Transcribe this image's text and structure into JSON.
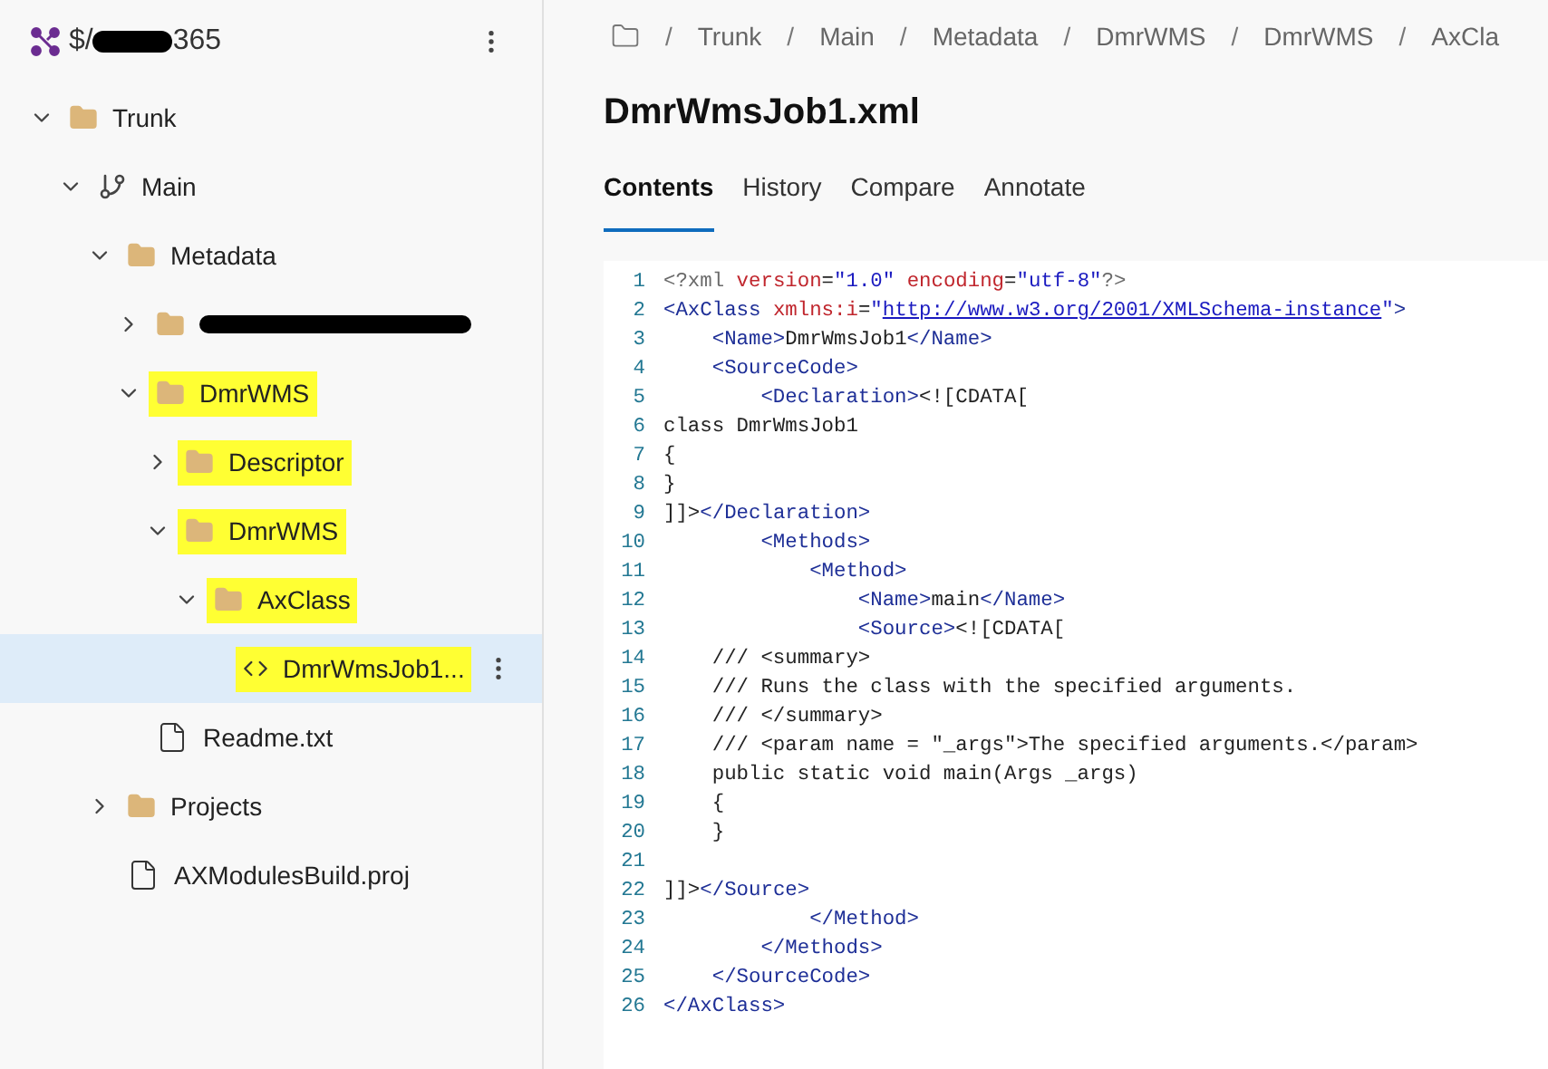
{
  "sidebar": {
    "repo": {
      "prefix": "$/",
      "suffix": "365",
      "redacted": true
    },
    "tree": [
      {
        "kind": "folder",
        "label": "Trunk",
        "expanded": true,
        "highlighted": false,
        "selected": false,
        "children": [
          {
            "kind": "branch",
            "label": "Main",
            "expanded": true,
            "highlighted": false,
            "selected": false,
            "children": [
              {
                "kind": "folder",
                "label": "Metadata",
                "expanded": true,
                "highlighted": false,
                "selected": false,
                "children": [
                  {
                    "kind": "folder",
                    "redacted": true,
                    "expanded": false,
                    "highlighted": false,
                    "selected": false
                  },
                  {
                    "kind": "folder",
                    "label": "DmrWMS",
                    "expanded": true,
                    "highlighted": true,
                    "selected": false,
                    "children": [
                      {
                        "kind": "folder",
                        "label": "Descriptor",
                        "expanded": false,
                        "highlighted": true,
                        "selected": false
                      },
                      {
                        "kind": "folder",
                        "label": "DmrWMS",
                        "expanded": true,
                        "highlighted": true,
                        "selected": false,
                        "children": [
                          {
                            "kind": "folder",
                            "label": "AxClass",
                            "expanded": true,
                            "highlighted": true,
                            "selected": false,
                            "children": [
                              {
                                "kind": "code",
                                "label": "DmrWmsJob1...",
                                "highlighted": true,
                                "selected": true
                              }
                            ]
                          }
                        ]
                      }
                    ]
                  },
                  {
                    "kind": "file",
                    "label": "Readme.txt",
                    "highlighted": false,
                    "selected": false
                  }
                ]
              },
              {
                "kind": "folder",
                "label": "Projects",
                "expanded": false,
                "highlighted": false,
                "selected": false
              },
              {
                "kind": "file",
                "label": "AXModulesBuild.proj",
                "highlighted": false,
                "selected": false
              }
            ]
          }
        ]
      }
    ]
  },
  "breadcrumb": [
    {
      "separator": "/",
      "label": "Trunk"
    },
    {
      "separator": "/",
      "label": "Main"
    },
    {
      "separator": "/",
      "label": "Metadata"
    },
    {
      "separator": "/",
      "label": "DmrWMS"
    },
    {
      "separator": "/",
      "label": "DmrWMS"
    },
    {
      "separator": "/",
      "label": "AxCla"
    }
  ],
  "title": "DmrWmsJob1.xml",
  "tabs": [
    {
      "label": "Contents",
      "selected": true
    },
    {
      "label": "History",
      "selected": false
    },
    {
      "label": "Compare",
      "selected": false
    },
    {
      "label": "Annotate",
      "selected": false
    }
  ],
  "code": [
    {
      "number": "1",
      "tokens": [
        {
          "kind": "punct",
          "text": "<?xml "
        },
        {
          "kind": "attr",
          "text": "version"
        },
        {
          "kind": "text",
          "text": "="
        },
        {
          "kind": "value",
          "text": "\"1.0\" "
        },
        {
          "kind": "attr",
          "text": "encoding"
        },
        {
          "kind": "text",
          "text": "="
        },
        {
          "kind": "value",
          "text": "\"utf-8\""
        },
        {
          "kind": "punct",
          "text": "?>"
        }
      ]
    },
    {
      "number": "2",
      "tokens": [
        {
          "kind": "tag",
          "text": "<AxClass "
        },
        {
          "kind": "attr",
          "text": "xmlns:i"
        },
        {
          "kind": "text",
          "text": "="
        },
        {
          "kind": "value",
          "text": "\""
        },
        {
          "kind": "link",
          "text": "http://www.w3.org/2001/XMLSchema-instance"
        },
        {
          "kind": "value",
          "text": "\""
        },
        {
          "kind": "tag",
          "text": ">"
        }
      ]
    },
    {
      "number": "3",
      "tokens": [
        {
          "kind": "tag",
          "text": "    <Name>"
        },
        {
          "kind": "text",
          "text": "DmrWmsJob1"
        },
        {
          "kind": "tag",
          "text": "</Name>"
        }
      ]
    },
    {
      "number": "4",
      "tokens": [
        {
          "kind": "tag",
          "text": "    <SourceCode>"
        }
      ]
    },
    {
      "number": "5",
      "tokens": [
        {
          "kind": "tag",
          "text": "        <Declaration>"
        },
        {
          "kind": "text",
          "text": "<![CDATA["
        }
      ]
    },
    {
      "number": "6",
      "tokens": [
        {
          "kind": "text",
          "text": "class DmrWmsJob1"
        }
      ]
    },
    {
      "number": "7",
      "tokens": [
        {
          "kind": "text",
          "text": "{"
        }
      ]
    },
    {
      "number": "8",
      "tokens": [
        {
          "kind": "text",
          "text": "}"
        }
      ]
    },
    {
      "number": "9",
      "tokens": [
        {
          "kind": "text",
          "text": "]]>"
        },
        {
          "kind": "tag",
          "text": "</Declaration>"
        }
      ]
    },
    {
      "number": "10",
      "tokens": [
        {
          "kind": "tag",
          "text": "        <Methods>"
        }
      ]
    },
    {
      "number": "11",
      "tokens": [
        {
          "kind": "tag",
          "text": "            <Method>"
        }
      ]
    },
    {
      "number": "12",
      "tokens": [
        {
          "kind": "tag",
          "text": "                <Name>"
        },
        {
          "kind": "text",
          "text": "main"
        },
        {
          "kind": "tag",
          "text": "</Name>"
        }
      ]
    },
    {
      "number": "13",
      "tokens": [
        {
          "kind": "tag",
          "text": "                <Source>"
        },
        {
          "kind": "text",
          "text": "<![CDATA["
        }
      ]
    },
    {
      "number": "14",
      "tokens": [
        {
          "kind": "text",
          "text": "    /// <summary>"
        }
      ]
    },
    {
      "number": "15",
      "tokens": [
        {
          "kind": "text",
          "text": "    /// Runs the class with the specified arguments."
        }
      ]
    },
    {
      "number": "16",
      "tokens": [
        {
          "kind": "text",
          "text": "    /// </summary>"
        }
      ]
    },
    {
      "number": "17",
      "tokens": [
        {
          "kind": "text",
          "text": "    /// <param name = \"_args\">The specified arguments.</param>"
        }
      ]
    },
    {
      "number": "18",
      "tokens": [
        {
          "kind": "text",
          "text": "    public static void main(Args _args)"
        }
      ]
    },
    {
      "number": "19",
      "tokens": [
        {
          "kind": "text",
          "text": "    {"
        }
      ]
    },
    {
      "number": "20",
      "tokens": [
        {
          "kind": "text",
          "text": "    }"
        }
      ]
    },
    {
      "number": "21"
    },
    {
      "number": "22",
      "tokens": [
        {
          "kind": "text",
          "text": "]]>"
        },
        {
          "kind": "tag",
          "text": "</Source>"
        }
      ]
    },
    {
      "number": "23",
      "tokens": [
        {
          "kind": "tag",
          "text": "            </Method>"
        }
      ]
    },
    {
      "number": "24",
      "tokens": [
        {
          "kind": "tag",
          "text": "        </Methods>"
        }
      ]
    },
    {
      "number": "25",
      "tokens": [
        {
          "kind": "tag",
          "text": "    </SourceCode>"
        }
      ]
    },
    {
      "number": "26",
      "tokens": [
        {
          "kind": "tag",
          "text": "</AxClass>"
        }
      ]
    }
  ]
}
